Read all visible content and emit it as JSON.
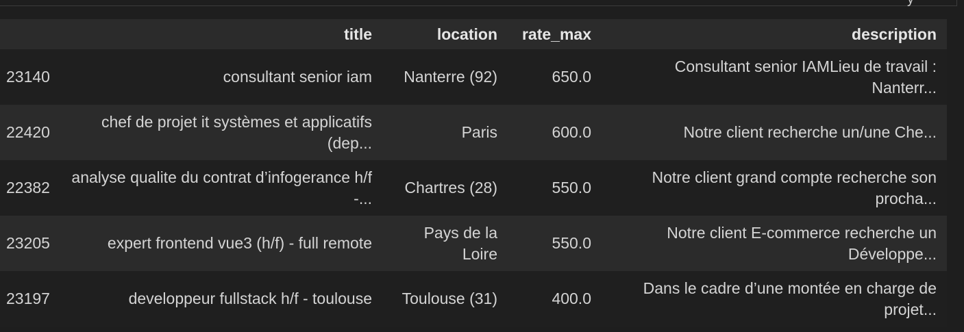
{
  "top_glyph": "y",
  "table": {
    "columns": [
      "",
      "title",
      "location",
      "rate_max",
      "description"
    ],
    "rows": [
      {
        "index": "23140",
        "title": "consultant senior iam",
        "location": "Nanterre (92)",
        "rate_max": "650.0",
        "description": "Consultant senior IAMLieu de travail : Nanterr..."
      },
      {
        "index": "22420",
        "title": "chef de projet it systèmes et applicatifs (dep...",
        "location": "Paris",
        "rate_max": "600.0",
        "description": "Notre client recherche un/une Che..."
      },
      {
        "index": "22382",
        "title": "analyse qualite du contrat d’infogerance h/f -...",
        "location": "Chartres (28)",
        "rate_max": "550.0",
        "description": "Notre client grand compte recherche son procha..."
      },
      {
        "index": "23205",
        "title": "expert frontend vue3 (h/f) - full remote",
        "location": "Pays de la Loire",
        "rate_max": "550.0",
        "description": "Notre client E-commerce recherche un Développe..."
      },
      {
        "index": "23197",
        "title": "developpeur fullstack h/f - toulouse",
        "location": "Toulouse (31)",
        "rate_max": "400.0",
        "description": "Dans le cadre d’une montée en charge de projet..."
      }
    ]
  }
}
